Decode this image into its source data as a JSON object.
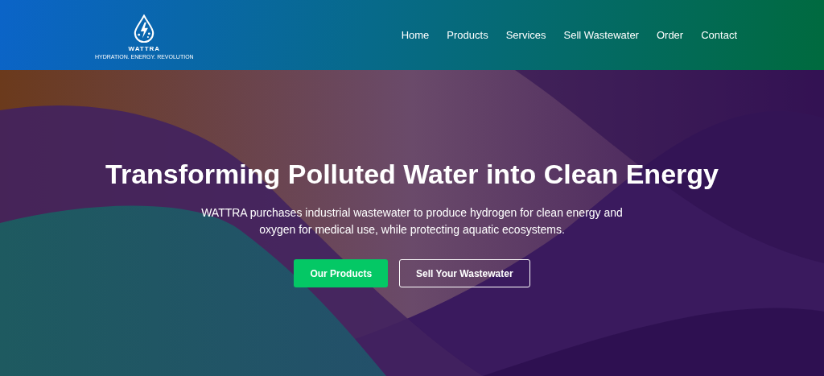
{
  "header": {
    "logo": {
      "name": "WATTRA",
      "tagline": "HYDRATION. ENERGY. REVOLUTION"
    },
    "nav": [
      {
        "label": "Home"
      },
      {
        "label": "Products"
      },
      {
        "label": "Services"
      },
      {
        "label": "Sell Wastewater"
      },
      {
        "label": "Order"
      },
      {
        "label": "Contact"
      }
    ]
  },
  "hero": {
    "title": "Transforming Polluted Water into Clean Energy",
    "text": "WATTRA purchases industrial wastewater to produce hydrogen for clean energy and oxygen for medical use, while protecting aquatic ecosystems.",
    "buttons": [
      {
        "label": "Our Products",
        "kind": "primary"
      },
      {
        "label": "Sell Your Wastewater",
        "kind": "outline"
      }
    ]
  }
}
